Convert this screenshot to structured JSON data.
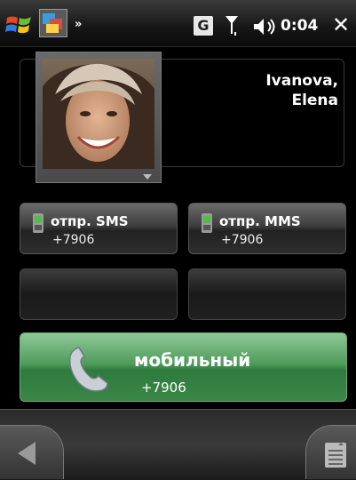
{
  "status_bar": {
    "network_badge": "G",
    "time": "0:04",
    "more_indicator": "»",
    "close_glyph": "✕",
    "icons": [
      "windows-start-icon",
      "app-switch-icon",
      "signal-icon",
      "volume-icon"
    ]
  },
  "contact": {
    "name_line1": "Ivanova,",
    "name_line2": "Elena"
  },
  "actions": [
    {
      "label": "отпр. SMS",
      "number": "+7906",
      "icon": "phone-sms-icon"
    },
    {
      "label": "отпр. MMS",
      "number": "+7906",
      "icon": "phone-mms-icon"
    }
  ],
  "call": {
    "label": "мобильный",
    "number": "+7906",
    "icon": "handset-icon",
    "color": "#3f8c4c"
  },
  "softkeys": {
    "left_icon": "back-arrow-icon",
    "right_icon": "menu-icon"
  }
}
